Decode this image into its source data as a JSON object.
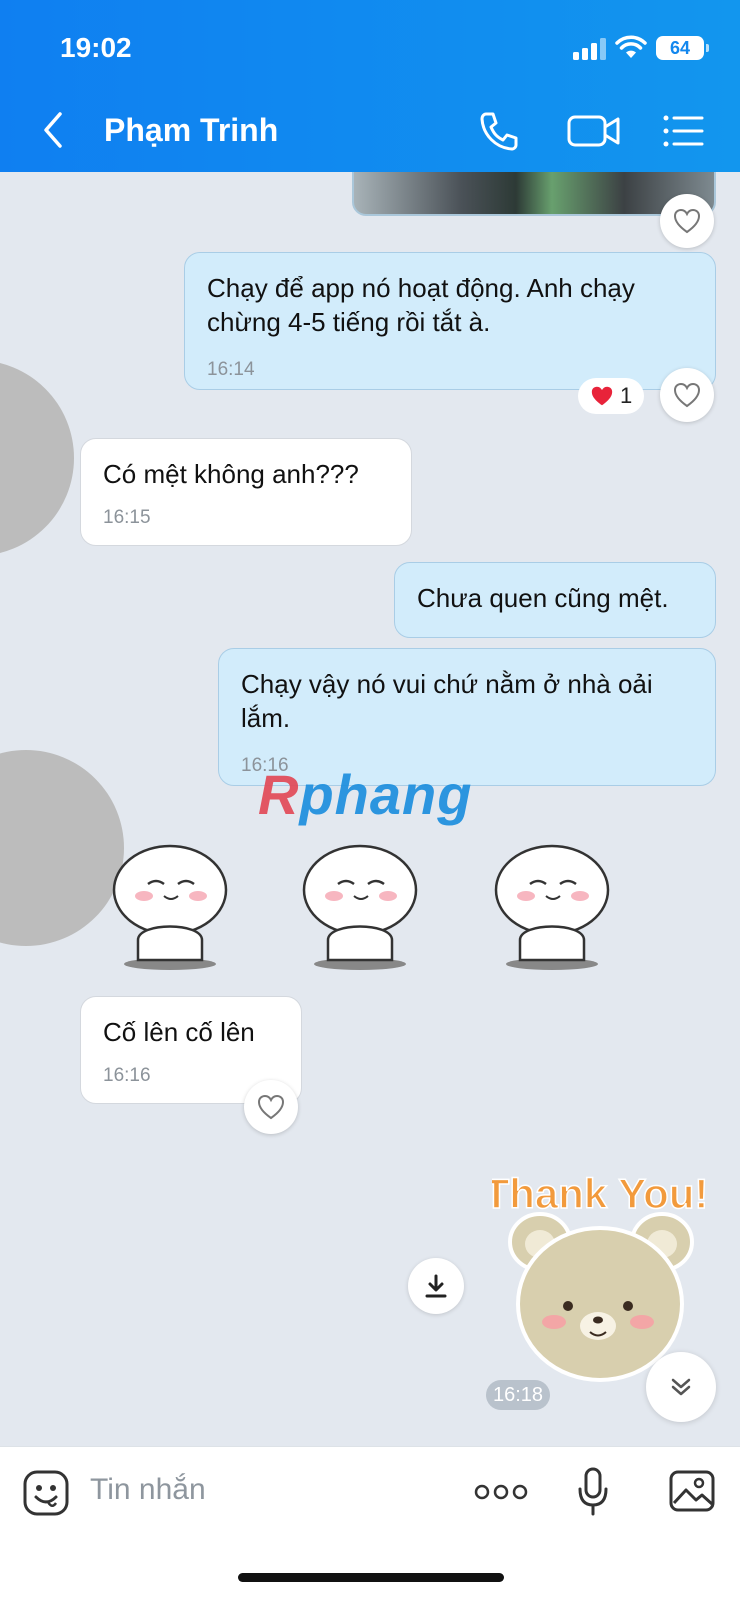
{
  "status_bar": {
    "time": "19:02",
    "battery": "64"
  },
  "header": {
    "contact_name": "Phạm Trinh"
  },
  "messages": [
    {
      "direction": "out",
      "text": "Chạy để app nó hoạt động. Anh chạy chừng 4-5 tiếng rồi tắt à.",
      "time": "16:14",
      "reaction_count": "1"
    },
    {
      "direction": "in",
      "text": "Có mệt không anh???",
      "time": "16:15"
    },
    {
      "direction": "out",
      "text": "Chưa quen cũng mệt."
    },
    {
      "direction": "out",
      "text": "Chạy vậy nó vui chứ nằm ở nhà oải lắm.",
      "time": "16:16"
    },
    {
      "direction": "in",
      "text": "Cố lên cố lên",
      "time": "16:16"
    }
  ],
  "sticker": {
    "caption": "Thank You!",
    "time": "16:18"
  },
  "watermark": {
    "prefix": "R",
    "rest": "phang"
  },
  "input": {
    "placeholder": "Tin nhắn"
  },
  "colors": {
    "header": "#0f7ff1",
    "bubble_out": "#d2ecfb",
    "bubble_in": "#ffffff",
    "background": "#e3e8ef",
    "reaction_heart": "#e8233a"
  },
  "icons": [
    "chevron-left-icon",
    "phone-icon",
    "video-call-icon",
    "menu-list-icon",
    "heart-icon",
    "download-icon",
    "chevron-down-icon",
    "emoji-icon",
    "more-icon",
    "microphone-icon",
    "image-icon"
  ]
}
